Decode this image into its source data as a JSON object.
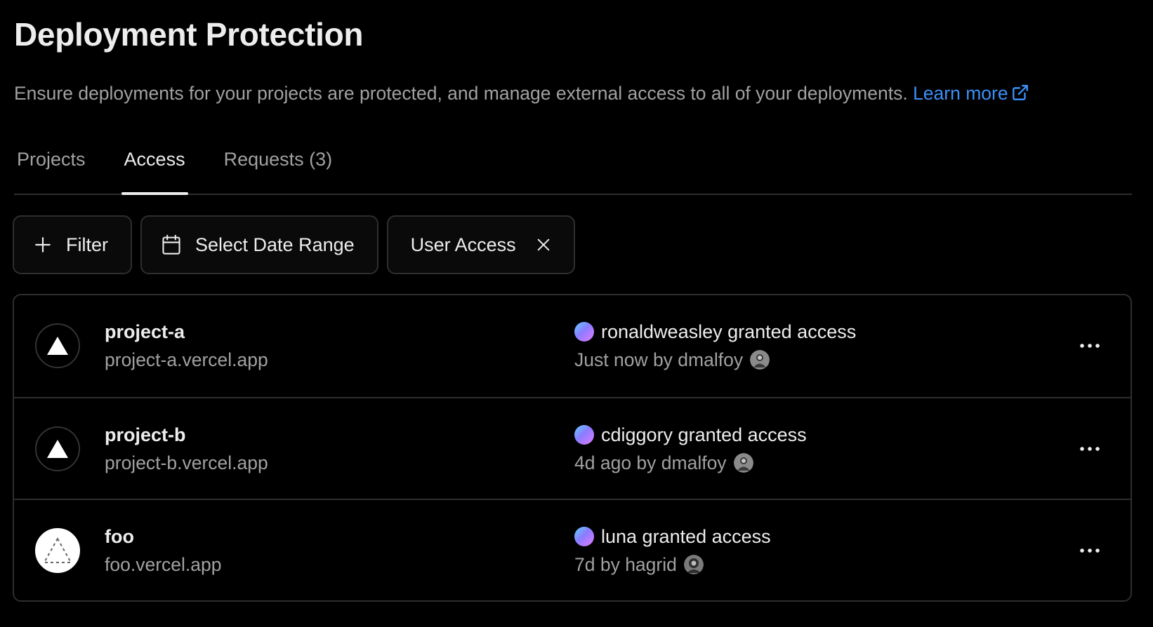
{
  "header": {
    "title": "Deployment Protection",
    "description": "Ensure deployments for your projects are protected, and manage external access to all of your deployments.",
    "learn_more": "Learn more"
  },
  "tabs": [
    {
      "label": "Projects",
      "active": false
    },
    {
      "label": "Access",
      "active": true
    },
    {
      "label": "Requests (3)",
      "active": false
    }
  ],
  "filters": {
    "filter_label": "Filter",
    "date_range_label": "Select Date Range",
    "active_filter_label": "User Access"
  },
  "rows": [
    {
      "name": "project-a",
      "domain": "project-a.vercel.app",
      "icon": "vercel-triangle-icon",
      "activity": "ronaldweasley granted access",
      "meta": "Just now by dmalfoy"
    },
    {
      "name": "project-b",
      "domain": "project-b.vercel.app",
      "icon": "vercel-triangle-icon",
      "activity": "cdiggory granted access",
      "meta": "4d ago by dmalfoy"
    },
    {
      "name": "foo",
      "domain": "foo.vercel.app",
      "icon": "dashed-triangle-icon",
      "activity": "luna granted access",
      "meta": "7d by hagrid"
    }
  ],
  "colors": {
    "background": "#000000",
    "link": "#3b8ff6",
    "border": "#2e2e2e",
    "muted_text": "#a1a1a1"
  }
}
